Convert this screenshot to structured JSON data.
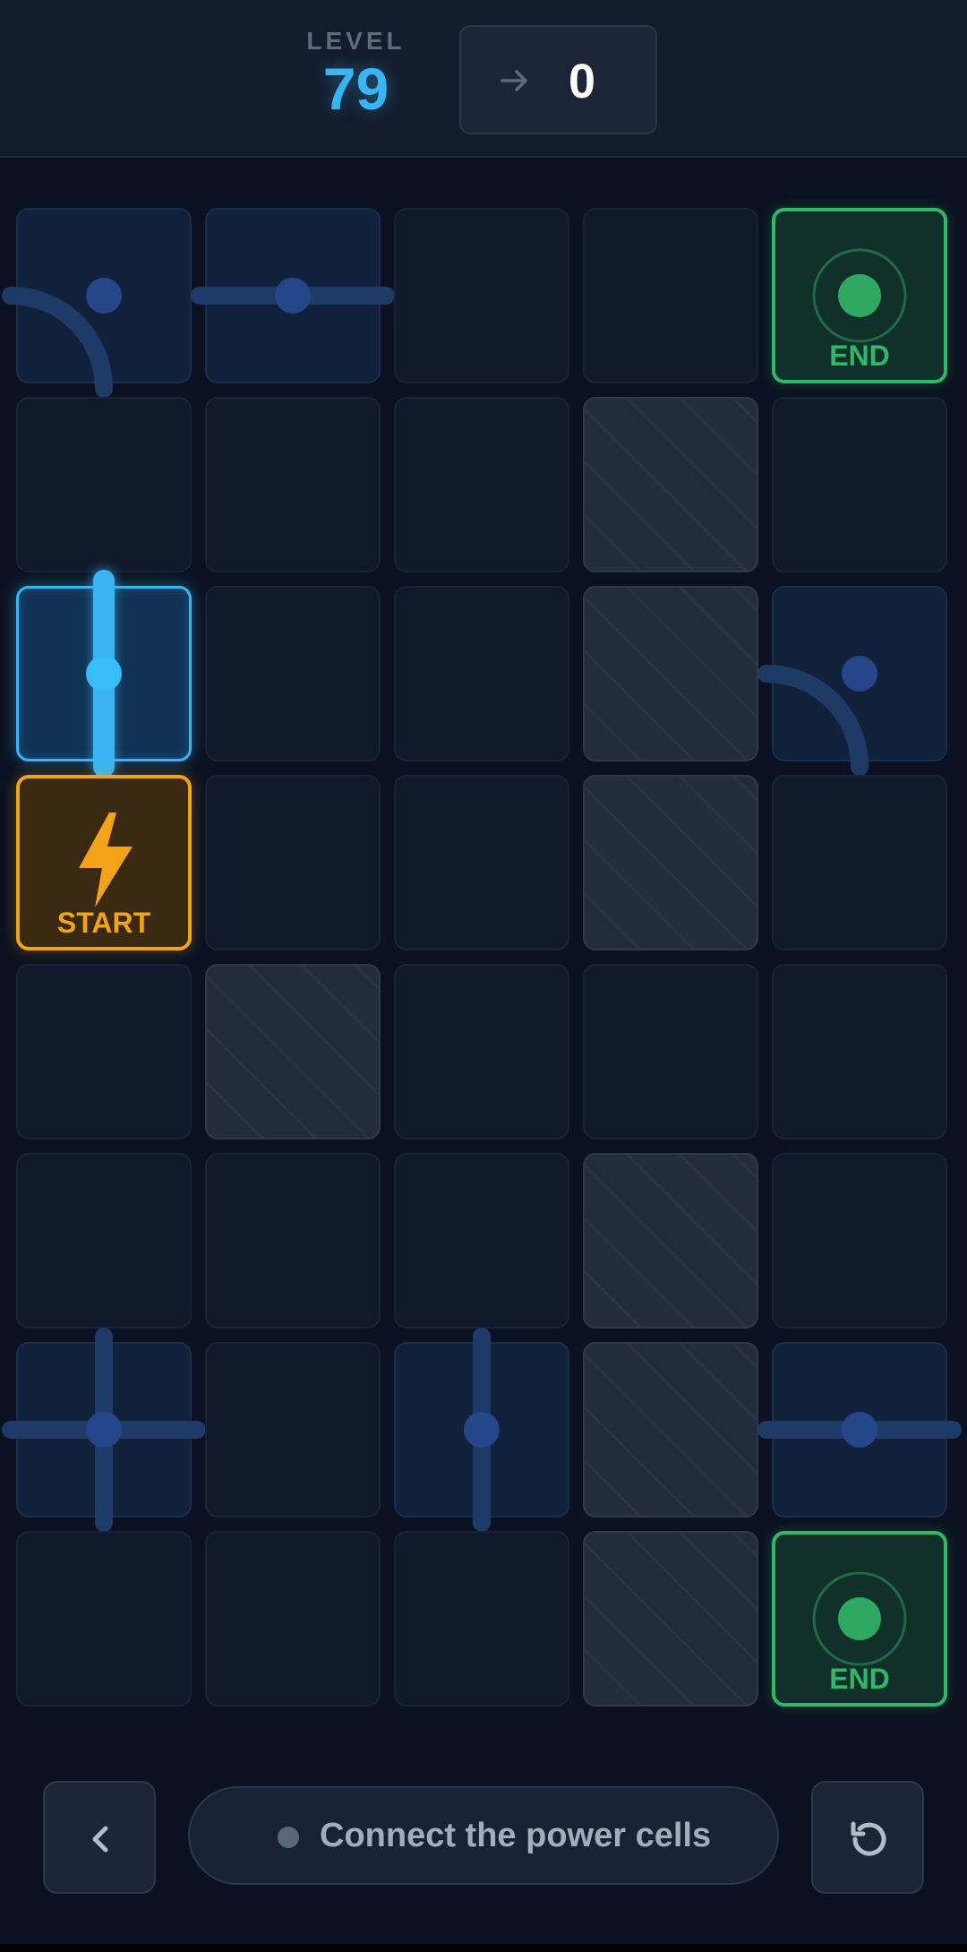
{
  "header": {
    "level_label": "LEVEL",
    "level_value": "79",
    "moves_icon": "arrow-right-icon",
    "moves_value": "0"
  },
  "board": {
    "rows": 8,
    "cols": 5,
    "start_label": "START",
    "end_label": "END",
    "cells": [
      [
        "pipe-curve-left-bottom",
        "pipe-straight-horizontal",
        "empty",
        "empty",
        "end"
      ],
      [
        "empty",
        "empty",
        "empty",
        "blocked",
        "empty"
      ],
      [
        "pipe-straight-vertical-powered",
        "empty",
        "empty",
        "blocked",
        "pipe-curve-left-bottom"
      ],
      [
        "start",
        "empty",
        "empty",
        "blocked",
        "empty"
      ],
      [
        "empty",
        "blocked",
        "empty",
        "empty",
        "empty"
      ],
      [
        "empty",
        "empty",
        "empty",
        "blocked",
        "empty"
      ],
      [
        "pipe-cross",
        "empty",
        "pipe-straight-vertical",
        "blocked",
        "pipe-straight-horizontal"
      ],
      [
        "empty",
        "empty",
        "empty",
        "blocked",
        "end"
      ]
    ]
  },
  "footer": {
    "back_icon": "chevron-left-icon",
    "status_text": "Connect the power cells",
    "reset_icon": "reset-icon"
  },
  "colors": {
    "background": "#0b1120",
    "accent": "#3ab4f2",
    "start": "#f2a318",
    "end": "#2fb86a",
    "pipe": "#1e3a66"
  }
}
